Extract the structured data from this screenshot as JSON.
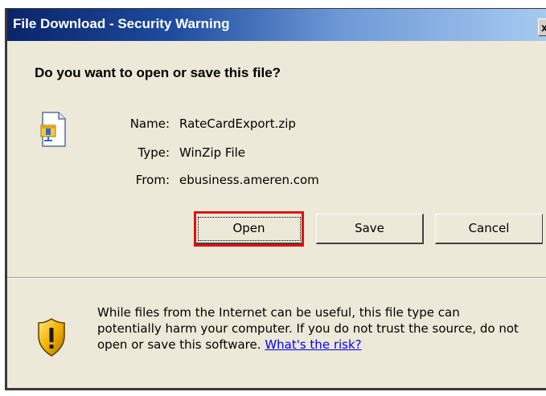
{
  "window": {
    "title": "File Download - Security Warning",
    "close_glyph": "x"
  },
  "dialog": {
    "question": "Do you want to open or save this file?",
    "file_icon": "zip-file-icon",
    "name_label": "Name:",
    "name_value": "RateCardExport.zip",
    "type_label": "Type:",
    "type_value": "WinZip File",
    "from_label": "From:",
    "from_value": "ebusiness.ameren.com"
  },
  "buttons": {
    "open": "Open",
    "save": "Save",
    "cancel": "Cancel"
  },
  "warning": {
    "icon": "shield-warning-icon",
    "line1": "While files from the Internet can be useful, this file type can",
    "line2": "potentially harm your computer. If you do not trust the source, do not",
    "line3": "open or save this software.",
    "link": "What's the risk?"
  },
  "colors": {
    "dialog_bg": "#ece9d8",
    "title_start": "#0a246a",
    "title_end": "#a6caf0",
    "highlight": "#e01010",
    "link": "#0000ff"
  }
}
